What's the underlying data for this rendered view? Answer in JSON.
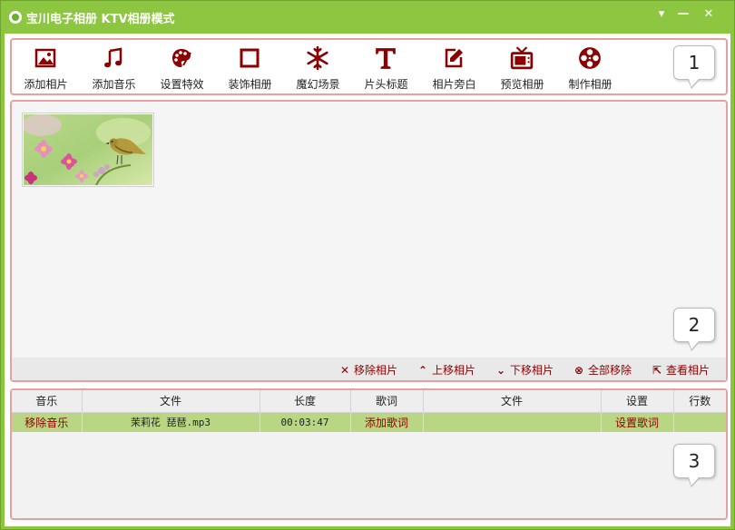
{
  "window": {
    "title": "宝川电子相册 KTV相册模式",
    "controls": {
      "menu": "▾",
      "minimize": "—",
      "close": "✕"
    }
  },
  "toolbar": {
    "items": [
      {
        "label": "添加相片",
        "icon": "add-photo-icon"
      },
      {
        "label": "添加音乐",
        "icon": "music-note-icon"
      },
      {
        "label": "设置特效",
        "icon": "palette-icon"
      },
      {
        "label": "装饰相册",
        "icon": "frame-icon"
      },
      {
        "label": "魔幻场景",
        "icon": "snowflake-icon"
      },
      {
        "label": "片头标题",
        "icon": "title-t-icon"
      },
      {
        "label": "相片旁白",
        "icon": "edit-note-icon"
      },
      {
        "label": "预览相册",
        "icon": "tv-icon"
      },
      {
        "label": "制作相册",
        "icon": "film-reel-icon"
      }
    ],
    "icon_color": "#8b0000"
  },
  "callouts": {
    "one": "1",
    "two": "2",
    "three": "3"
  },
  "photos": {
    "items": [
      {
        "thumbnail": "flowers-bird-thumbnail"
      }
    ]
  },
  "photo_actions": {
    "remove": {
      "icon": "✕",
      "label": "移除相片"
    },
    "move_up": {
      "icon": "⌃",
      "label": "上移相片"
    },
    "move_down": {
      "icon": "⌄",
      "label": "下移相片"
    },
    "remove_all": {
      "icon": "⊗",
      "label": "全部移除"
    },
    "view": {
      "icon": "⇱",
      "label": "查看相片"
    }
  },
  "music_table": {
    "headers": [
      "音乐",
      "文件",
      "长度",
      "歌词",
      "文件",
      "设置",
      "行数"
    ],
    "rows": [
      {
        "music": "移除音乐",
        "file": "茉莉花 琵琶.mp3",
        "length": "00:03:47",
        "lyrics": "添加歌词",
        "lyrics_file": "",
        "settings": "设置歌词",
        "lines": ""
      }
    ]
  },
  "colors": {
    "titlebar": "#8dc641",
    "panel_border": "#e7a0a0",
    "accent_dark_red": "#8b0000",
    "selected_row": "#b9d783"
  }
}
